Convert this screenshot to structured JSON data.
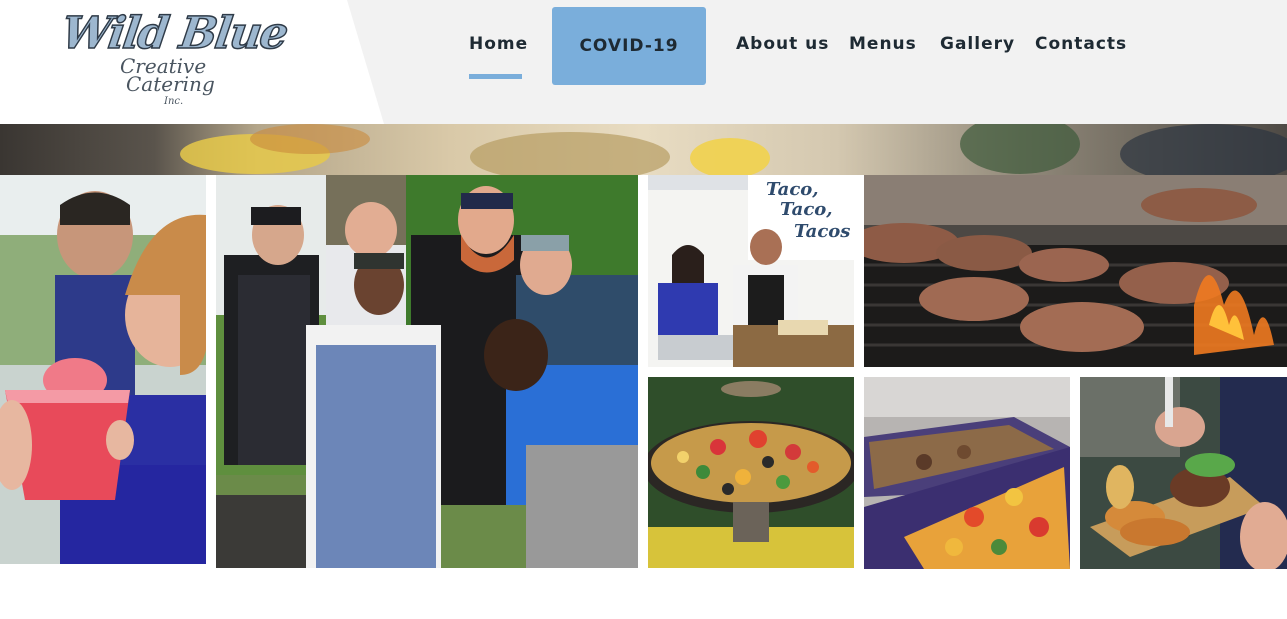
{
  "logo": {
    "line1": "Wild Blue",
    "line2": "Creative",
    "line3": "Catering",
    "line4": "Inc."
  },
  "nav": {
    "items": [
      {
        "label": "Home",
        "active": true
      },
      {
        "label": "COVID-19",
        "highlighted": true
      },
      {
        "label": "About us"
      },
      {
        "label": "Menus"
      },
      {
        "label": "Gallery"
      },
      {
        "label": "Contacts"
      }
    ]
  },
  "gallery": {
    "sign_line1": "Taco,",
    "sign_line2": "Taco,",
    "sign_line3": "Tacos"
  },
  "colors": {
    "accent": "#7aaedb",
    "header_bg": "#f2f2f2",
    "nav_text": "#1e2a33"
  }
}
